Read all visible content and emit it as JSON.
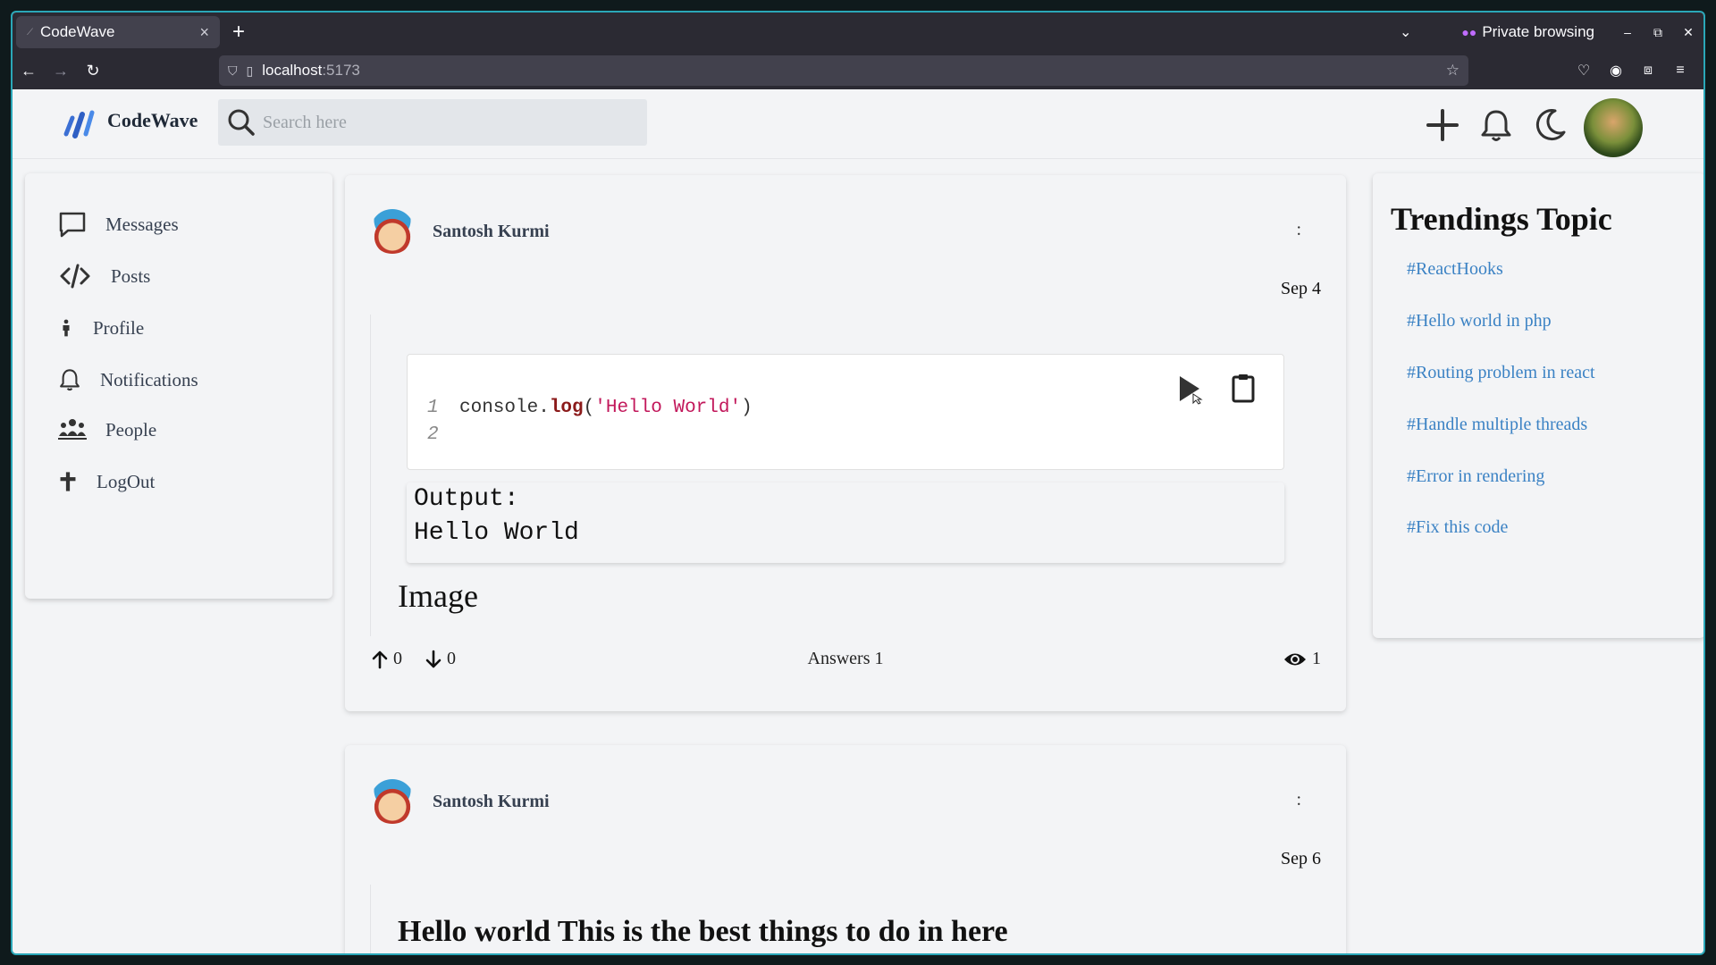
{
  "browser": {
    "tab_title": "CodeWave",
    "private_label": "Private browsing",
    "url_host": "localhost",
    "url_port": ":5173"
  },
  "header": {
    "brand": "CodeWave",
    "search_placeholder": "Search here"
  },
  "sidebar": {
    "items": [
      {
        "label": "Messages"
      },
      {
        "label": "Posts"
      },
      {
        "label": "Profile"
      },
      {
        "label": "Notifications"
      },
      {
        "label": "People"
      },
      {
        "label": "LogOut"
      }
    ]
  },
  "posts": [
    {
      "author": "Santosh Kurmi",
      "menu": ":",
      "date": "Sep 4",
      "code": {
        "line_numbers": [
          "1",
          "2"
        ],
        "tokens": {
          "obj": "console.",
          "fn": "log",
          "open": "(",
          "str": "'Hello World'",
          "close": ")"
        }
      },
      "output_label": "Output:",
      "output_text": "Hello World",
      "image_label": "Image",
      "upvotes": "0",
      "downvotes": "0",
      "answers": "Answers 1",
      "views": "1"
    },
    {
      "author": "Santosh Kurmi",
      "menu": ":",
      "date": "Sep 6",
      "title": "Hello world This is the best things to do in here"
    }
  ],
  "trending": {
    "heading": "Trendings Topic",
    "tags": [
      "#ReactHooks",
      "#Hello world in php",
      "#Routing problem in react",
      "#Handle multiple threads",
      "#Error in rendering",
      "#Fix this code"
    ]
  },
  "colors": {
    "accent_link": "#3b82c4",
    "code_fn": "#8b1a1a",
    "code_string": "#c2185b",
    "window_border": "#2aa7b8"
  }
}
